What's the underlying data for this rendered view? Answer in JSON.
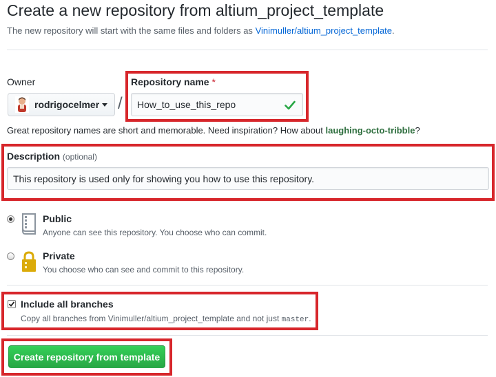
{
  "header": {
    "title": "Create a new repository from altium_project_template",
    "subtitle_prefix": "The new repository will start with the same files and folders as",
    "subtitle_link": "Vinimuller/altium_project_template",
    "subtitle_suffix": "."
  },
  "owner": {
    "label": "Owner",
    "name": "rodrigocelmer",
    "separator": "/"
  },
  "repo_name": {
    "label": "Repository name",
    "required_mark": "*",
    "value": "How_to_use_this_repo",
    "status_icon": "check-icon"
  },
  "hint": {
    "text": "Great repository names are short and memorable. Need inspiration? How about",
    "suggestion": "laughing-octo-tribble",
    "suffix": "?"
  },
  "description": {
    "label": "Description",
    "optional": "(optional)",
    "value": "This repository is used only for showing you how to use this repository."
  },
  "visibility": {
    "selected": "Public",
    "options": [
      {
        "title": "Public",
        "note": "Anyone can see this repository. You choose who can commit.",
        "icon": "repo-book-icon"
      },
      {
        "title": "Private",
        "note": "You choose who can see and commit to this repository.",
        "icon": "lock-icon"
      }
    ]
  },
  "branches": {
    "checked": true,
    "title": "Include all branches",
    "note_prefix": "Copy all branches from Vinimuller/altium_project_template and not just",
    "note_code": "master",
    "note_suffix": "."
  },
  "submit": {
    "label": "Create repository from template"
  },
  "colors": {
    "highlight": "#d7262b",
    "primary_button": "#2ea44f",
    "link": "#0366d6",
    "success": "#28a745"
  }
}
